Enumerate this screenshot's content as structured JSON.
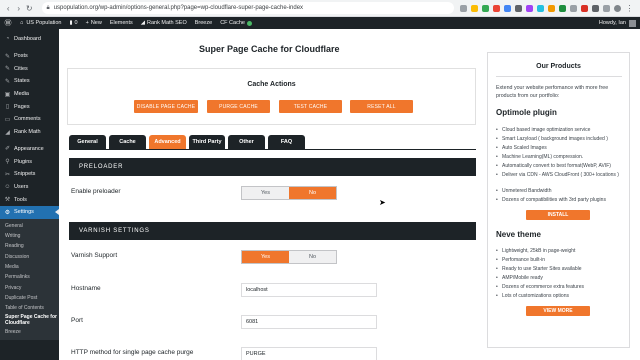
{
  "browser": {
    "url": "uspopulation.org/wp-admin/options-general.php?page=wp-cloudflare-super-page-cache-index"
  },
  "adminbar": {
    "site_name": "US Population",
    "comments_count": "0",
    "new_label": "New",
    "items": [
      "Elements",
      "Rank Math SEO",
      "Breeze",
      "CF Cache"
    ],
    "greeting": "Howdy, Ian"
  },
  "sidebar": {
    "items": [
      {
        "label": "Dashboard",
        "icon": "dashboard-icon"
      },
      {
        "label": "Posts",
        "icon": "pin-icon"
      },
      {
        "label": "Cities",
        "icon": "pin-icon"
      },
      {
        "label": "States",
        "icon": "pin-icon"
      },
      {
        "label": "Media",
        "icon": "media-icon"
      },
      {
        "label": "Pages",
        "icon": "page-icon"
      },
      {
        "label": "Comments",
        "icon": "comment-icon"
      },
      {
        "label": "Rank Math",
        "icon": "chart-icon"
      },
      {
        "label": "Appearance",
        "icon": "brush-icon"
      },
      {
        "label": "Plugins",
        "icon": "plugin-icon"
      },
      {
        "label": "Snippets",
        "icon": "code-icon"
      },
      {
        "label": "Users",
        "icon": "user-icon"
      },
      {
        "label": "Tools",
        "icon": "wrench-icon"
      },
      {
        "label": "Settings",
        "icon": "settings-icon"
      }
    ],
    "submenu": [
      "General",
      "Writing",
      "Reading",
      "Discussion",
      "Media",
      "Permalinks",
      "Privacy",
      "Duplicate Post",
      "Table of Contents",
      "Super Page Cache for Cloudflare",
      "Breeze"
    ]
  },
  "page": {
    "title": "Super Page Cache for Cloudflare"
  },
  "actions": {
    "title": "Cache Actions",
    "buttons": [
      "DISABLE PAGE CACHE",
      "PURGE CACHE",
      "TEST CACHE",
      "RESET ALL"
    ]
  },
  "tabs": [
    "General",
    "Cache",
    "Advanced",
    "Third Party",
    "Other",
    "FAQ"
  ],
  "active_tab": "Advanced",
  "preloader": {
    "heading": "PRELOADER",
    "enable_label": "Enable preloader",
    "options": [
      "Yes",
      "No"
    ],
    "selected": "No"
  },
  "varnish": {
    "heading": "VARNISH SETTINGS",
    "support_label": "Varnish Support",
    "options": [
      "Yes",
      "No"
    ],
    "selected": "Yes",
    "hostname_label": "Hostname",
    "hostname_value": "localhost",
    "port_label": "Port",
    "port_value": "6081",
    "purge_method_label": "HTTP method for single page cache purge",
    "purge_method_value": "PURGE"
  },
  "panel": {
    "title": "Our Products",
    "desc": "Extend your website perfomance with more free products from our portfolio:",
    "product1": {
      "name": "Optimole plugin",
      "features": [
        "Cloud based image optimization service",
        "Smart Lazyload ( background images included )",
        "Auto Scaled Images",
        "Machine Learning(ML) compression.",
        "Automatically convert to best format(WebP, AVIF)",
        "Deliver via CDN - AWS CloudFront ( 300+ locations )",
        "Unmetered Bandwidth",
        "Dozens of compatibilities with 3rd party plugins"
      ],
      "button": "INSTALL"
    },
    "product2": {
      "name": "Neve theme",
      "features": [
        "Lightweight, 25kB in page-weight",
        "Perfomance built-in",
        "Ready to use Starter Sites available",
        "AMP/Mobile ready",
        "Dozens of ecommerce extra features",
        "Lots of customizations options"
      ],
      "button": "VIEW MORE"
    }
  },
  "colors": {
    "accent": "#f0762c",
    "dark": "#1d2327",
    "wp_blue": "#2271b1"
  }
}
